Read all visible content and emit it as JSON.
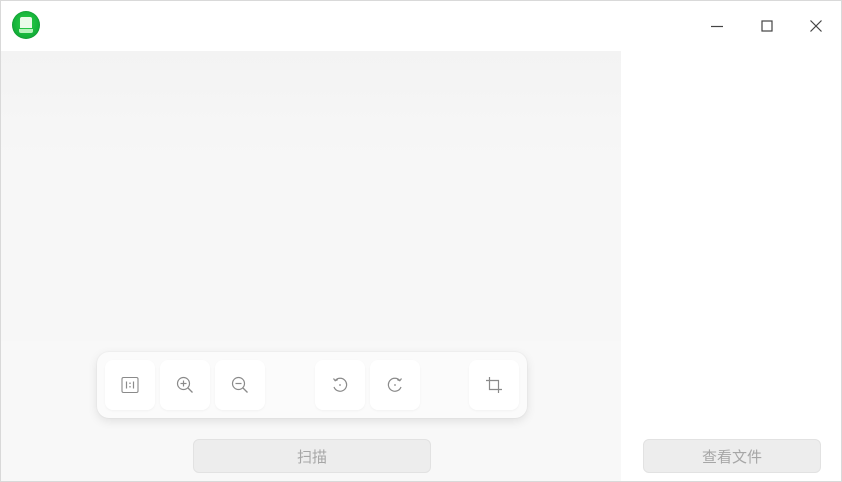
{
  "app": {
    "logo_icon": "scanner-app-logo",
    "accent_color": "#15b23a"
  },
  "window_controls": {
    "minimize_icon": "minimize-icon",
    "maximize_icon": "maximize-icon",
    "close_icon": "close-icon"
  },
  "toolbar": {
    "tools": [
      {
        "id": "actual-size",
        "icon": "actual-size-1-1-icon"
      },
      {
        "id": "zoom-in",
        "icon": "zoom-in-icon"
      },
      {
        "id": "zoom-out",
        "icon": "zoom-out-icon"
      },
      {
        "id": "rotate-left",
        "icon": "rotate-counterclockwise-icon"
      },
      {
        "id": "rotate-right",
        "icon": "rotate-clockwise-icon"
      },
      {
        "id": "crop",
        "icon": "crop-icon"
      }
    ]
  },
  "actions": {
    "scan_label": "扫描",
    "view_files_label": "查看文件",
    "disabled_text_color": "#a6a6a6"
  }
}
